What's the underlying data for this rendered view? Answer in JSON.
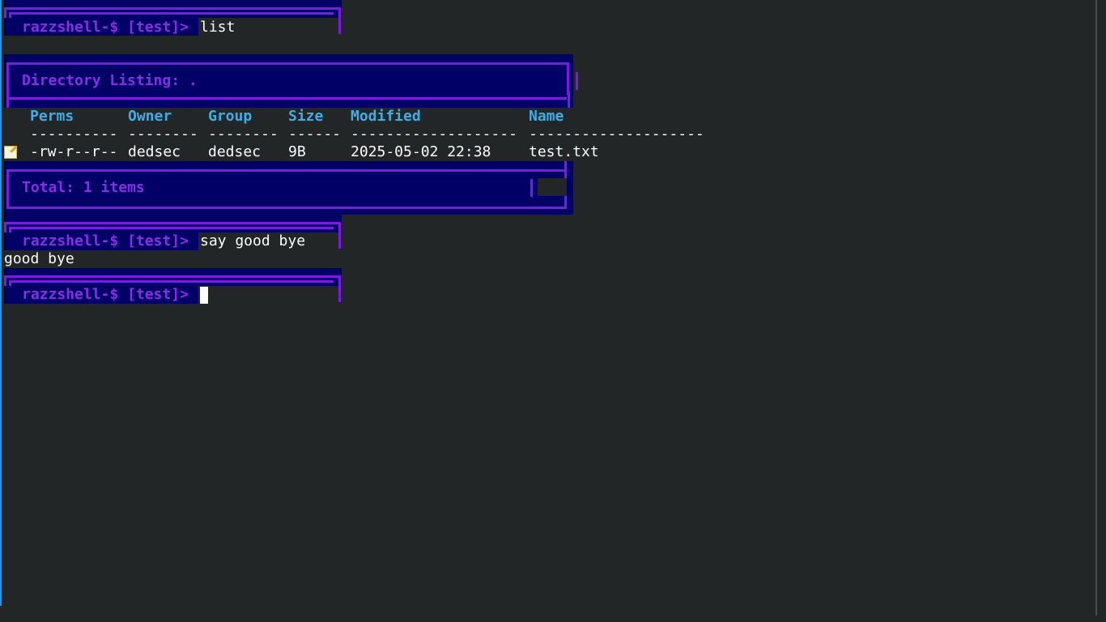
{
  "terminal": {
    "prompt": "razzshell-$ [test]>",
    "commands": [
      {
        "input": "list"
      },
      {
        "input": "say good bye",
        "output": "good bye"
      },
      {
        "input": ""
      }
    ]
  },
  "listing": {
    "title": "Directory Listing: .",
    "columns": [
      "Perms",
      "Owner",
      "Group",
      "Size",
      "Modified",
      "Name"
    ],
    "dashes": [
      "----------",
      "--------",
      "--------",
      "------",
      "-------------------",
      "--------------------"
    ],
    "rows": [
      {
        "icon": "memo-icon",
        "perms": "-rw-r--r--",
        "owner": "dedsec",
        "group": "dedsec",
        "size": "9B",
        "modified": "2025-05-02 22:38",
        "name": "test.txt"
      }
    ],
    "total": "Total: 1 items"
  },
  "colors": {
    "background": "#232627",
    "banner": "#000066",
    "frame": "#7a1be0",
    "prompt": "#8b2be6",
    "header": "#3daee9",
    "text": "#fcfcfc"
  }
}
